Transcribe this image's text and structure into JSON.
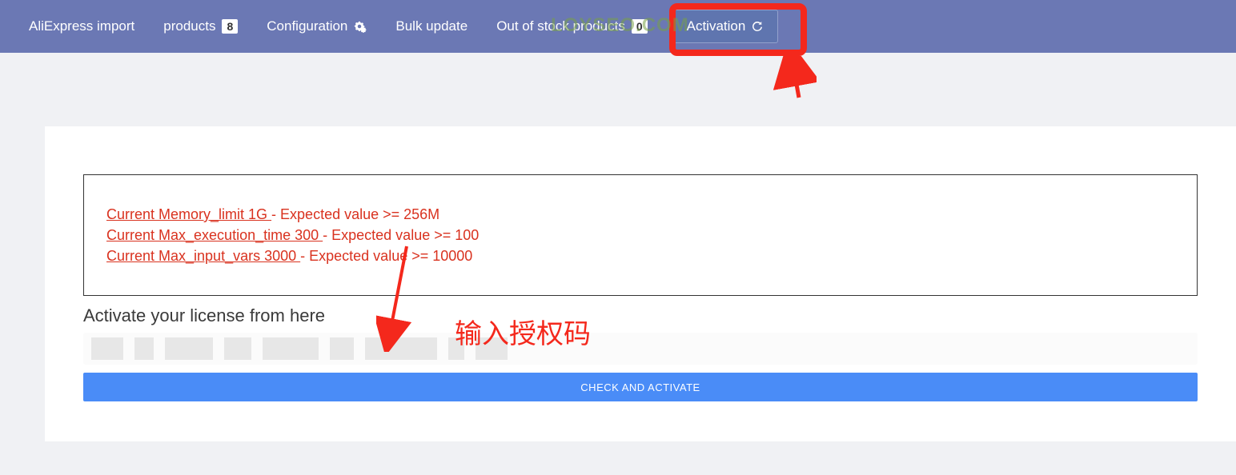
{
  "nav": {
    "items": [
      {
        "label": "AliExpress import",
        "badge": null,
        "icon": null
      },
      {
        "label": "products",
        "badge": "8",
        "icon": null
      },
      {
        "label": "Configuration",
        "badge": null,
        "icon": "gears"
      },
      {
        "label": "Bulk update",
        "badge": null,
        "icon": null
      },
      {
        "label": "Out of stock products",
        "badge": "0",
        "icon": null
      }
    ],
    "active": {
      "label": "Activation",
      "icon": "refresh"
    }
  },
  "alerts": [
    {
      "link": "Current Memory_limit 1G ",
      "rest": "- Expected value >= 256M"
    },
    {
      "link": "Current Max_execution_time 300 ",
      "rest": "- Expected value >= 100"
    },
    {
      "link": "Current Max_input_vars 3000 ",
      "rest": "- Expected value >= 10000"
    }
  ],
  "license": {
    "title": "Activate your license from here",
    "button": "CHECK AND ACTIVATE"
  },
  "overlay": {
    "watermark": "LOYSEO.COM",
    "annotation": "输入授权码"
  }
}
